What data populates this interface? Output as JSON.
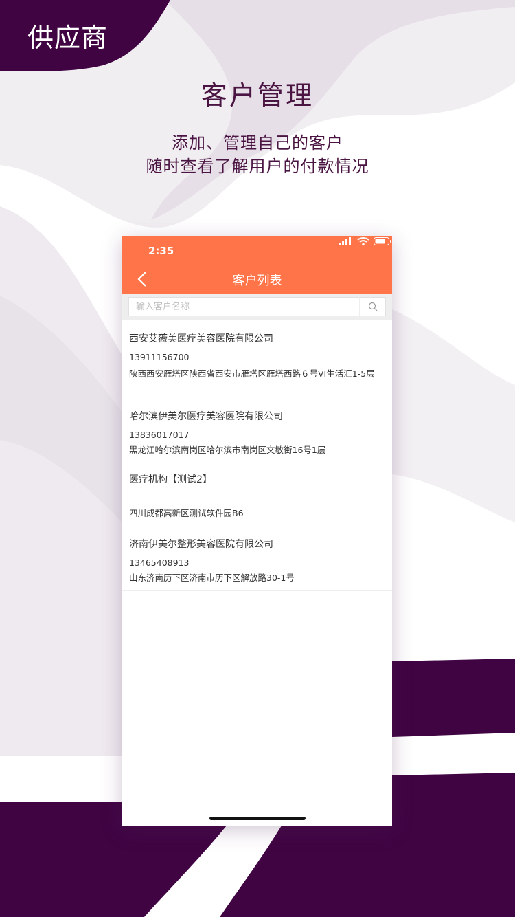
{
  "brand": {
    "tag": "供应商"
  },
  "header": {
    "title": "客户管理",
    "subtitle_line1": "添加、管理自己的客户",
    "subtitle_line2": "随时查看了解用户的付款情况"
  },
  "colors": {
    "accent": "#ff7448",
    "brand_purple": "#400443",
    "text_purple": "#4a1443"
  },
  "phone": {
    "status": {
      "time": "2:35",
      "icons": [
        "signal-icon",
        "wifi-icon",
        "battery-icon"
      ]
    },
    "nav": {
      "title": "客户列表",
      "back_icon": "chevron-left-icon"
    },
    "search": {
      "placeholder": "输入客户名称",
      "value": "",
      "icon": "search-icon"
    },
    "customers": [
      {
        "name": "西安艾薇美医疗美容医院有限公司",
        "phone": "13911156700",
        "address": "陕西西安雁塔区陕西省西安市雁塔区雁塔西路６号VI生活汇1-5层"
      },
      {
        "name": "哈尔滨伊美尔医疗美容医院有限公司",
        "phone": "13836017017",
        "address": "黑龙江哈尔滨南岗区哈尔滨市南岗区文敏街16号1层"
      },
      {
        "name": "医疗机构【测试2】",
        "phone": "",
        "address": "四川成都高新区测试软件园B6"
      },
      {
        "name": "济南伊美尔整形美容医院有限公司",
        "phone": "13465408913",
        "address": "山东济南历下区济南市历下区解放路30-1号"
      }
    ]
  }
}
